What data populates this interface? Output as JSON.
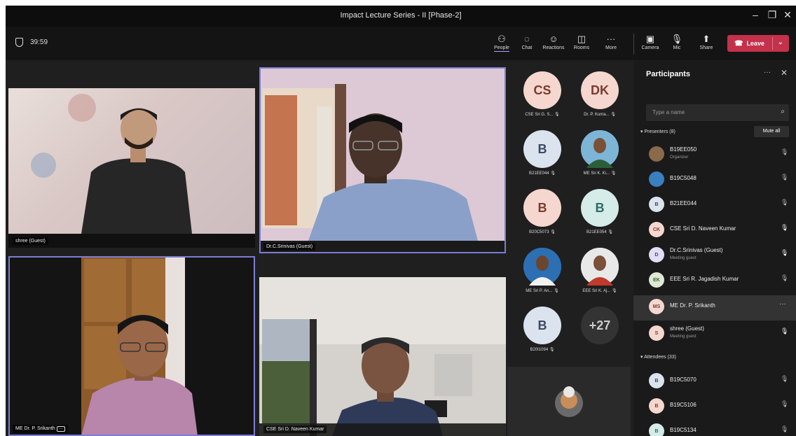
{
  "window": {
    "title": "Impact Lecture Series - II [Phase-2]"
  },
  "window_controls": {
    "minimize": "–",
    "restore": "❐",
    "close": "✕"
  },
  "meeting": {
    "elapsed_time": "39:59"
  },
  "toolbar": {
    "people": "People",
    "chat": "Chat",
    "reactions": "Reactions",
    "rooms": "Rooms",
    "more": "More",
    "camera": "Camera",
    "mic": "Mic",
    "share": "Share",
    "leave": "Leave"
  },
  "icons": {
    "people": "people-icon",
    "chat": "chat-icon",
    "reactions": "reactions-icon",
    "rooms": "rooms-icon",
    "more": "more-icon",
    "camera": "camera-icon",
    "mic": "mic-muted-icon",
    "share": "share-icon",
    "leave": "phone-icon",
    "shield": "shield-icon",
    "search": "search-icon"
  },
  "video_tiles": [
    {
      "name": "shree (Guest)"
    },
    {
      "name": "Dr.C.Srinivas (Guest)"
    },
    {
      "name": "ME Dr. P. Srikanth"
    },
    {
      "name": "CSE Sri D. Naveen Kumar"
    }
  ],
  "roster": [
    {
      "initials": "CS",
      "label": "CSE Sri G. S..."
    },
    {
      "initials": "DK",
      "label": "Dr. P. Kuma..."
    },
    {
      "initials": "B",
      "label": "B21EE044"
    },
    {
      "initials": "",
      "label": "ME Sri K. Ki..."
    },
    {
      "initials": "B",
      "label": "B20C5073"
    },
    {
      "initials": "B",
      "label": "B21EE054"
    },
    {
      "initials": "",
      "label": "ME Sri P. An..."
    },
    {
      "initials": "",
      "label": "EEE Sri K. Aj..."
    },
    {
      "initials": "B",
      "label": "B20I1094"
    },
    {
      "initials": "+27",
      "label": ""
    }
  ],
  "participants_panel": {
    "title": "Participants",
    "search_placeholder": "Type a name",
    "presenters_header": "Presenters (8)",
    "mute_all": "Mute all",
    "attendees_header": "Attendees (33)",
    "rows": [
      {
        "initials": "",
        "name": "B19EE050",
        "subtitle": "Organizer"
      },
      {
        "initials": "",
        "name": "B19C5048",
        "subtitle": ""
      },
      {
        "initials": "B",
        "name": "B21EE044",
        "subtitle": ""
      },
      {
        "initials": "CK",
        "name": "CSE Sri D. Naveen Kumar",
        "subtitle": ""
      },
      {
        "initials": "D",
        "name": "Dr.C.Srinivas (Guest)",
        "subtitle": "Meeting guest"
      },
      {
        "initials": "EK",
        "name": "EEE Sri R. Jagadish Kumar",
        "subtitle": ""
      },
      {
        "initials": "MS",
        "name": "ME Dr. P. Srikanth",
        "subtitle": ""
      },
      {
        "initials": "S",
        "name": "shree (Guest)",
        "subtitle": "Meeting guest"
      },
      {
        "initials": "B",
        "name": "B19C5070",
        "subtitle": ""
      },
      {
        "initials": "B",
        "name": "B19C5106",
        "subtitle": ""
      },
      {
        "initials": "B",
        "name": "B19C5134",
        "subtitle": ""
      }
    ]
  },
  "colors": {
    "accent": "#7c7cd6",
    "leave": "#c4314b",
    "background": "#1f1f1f"
  }
}
